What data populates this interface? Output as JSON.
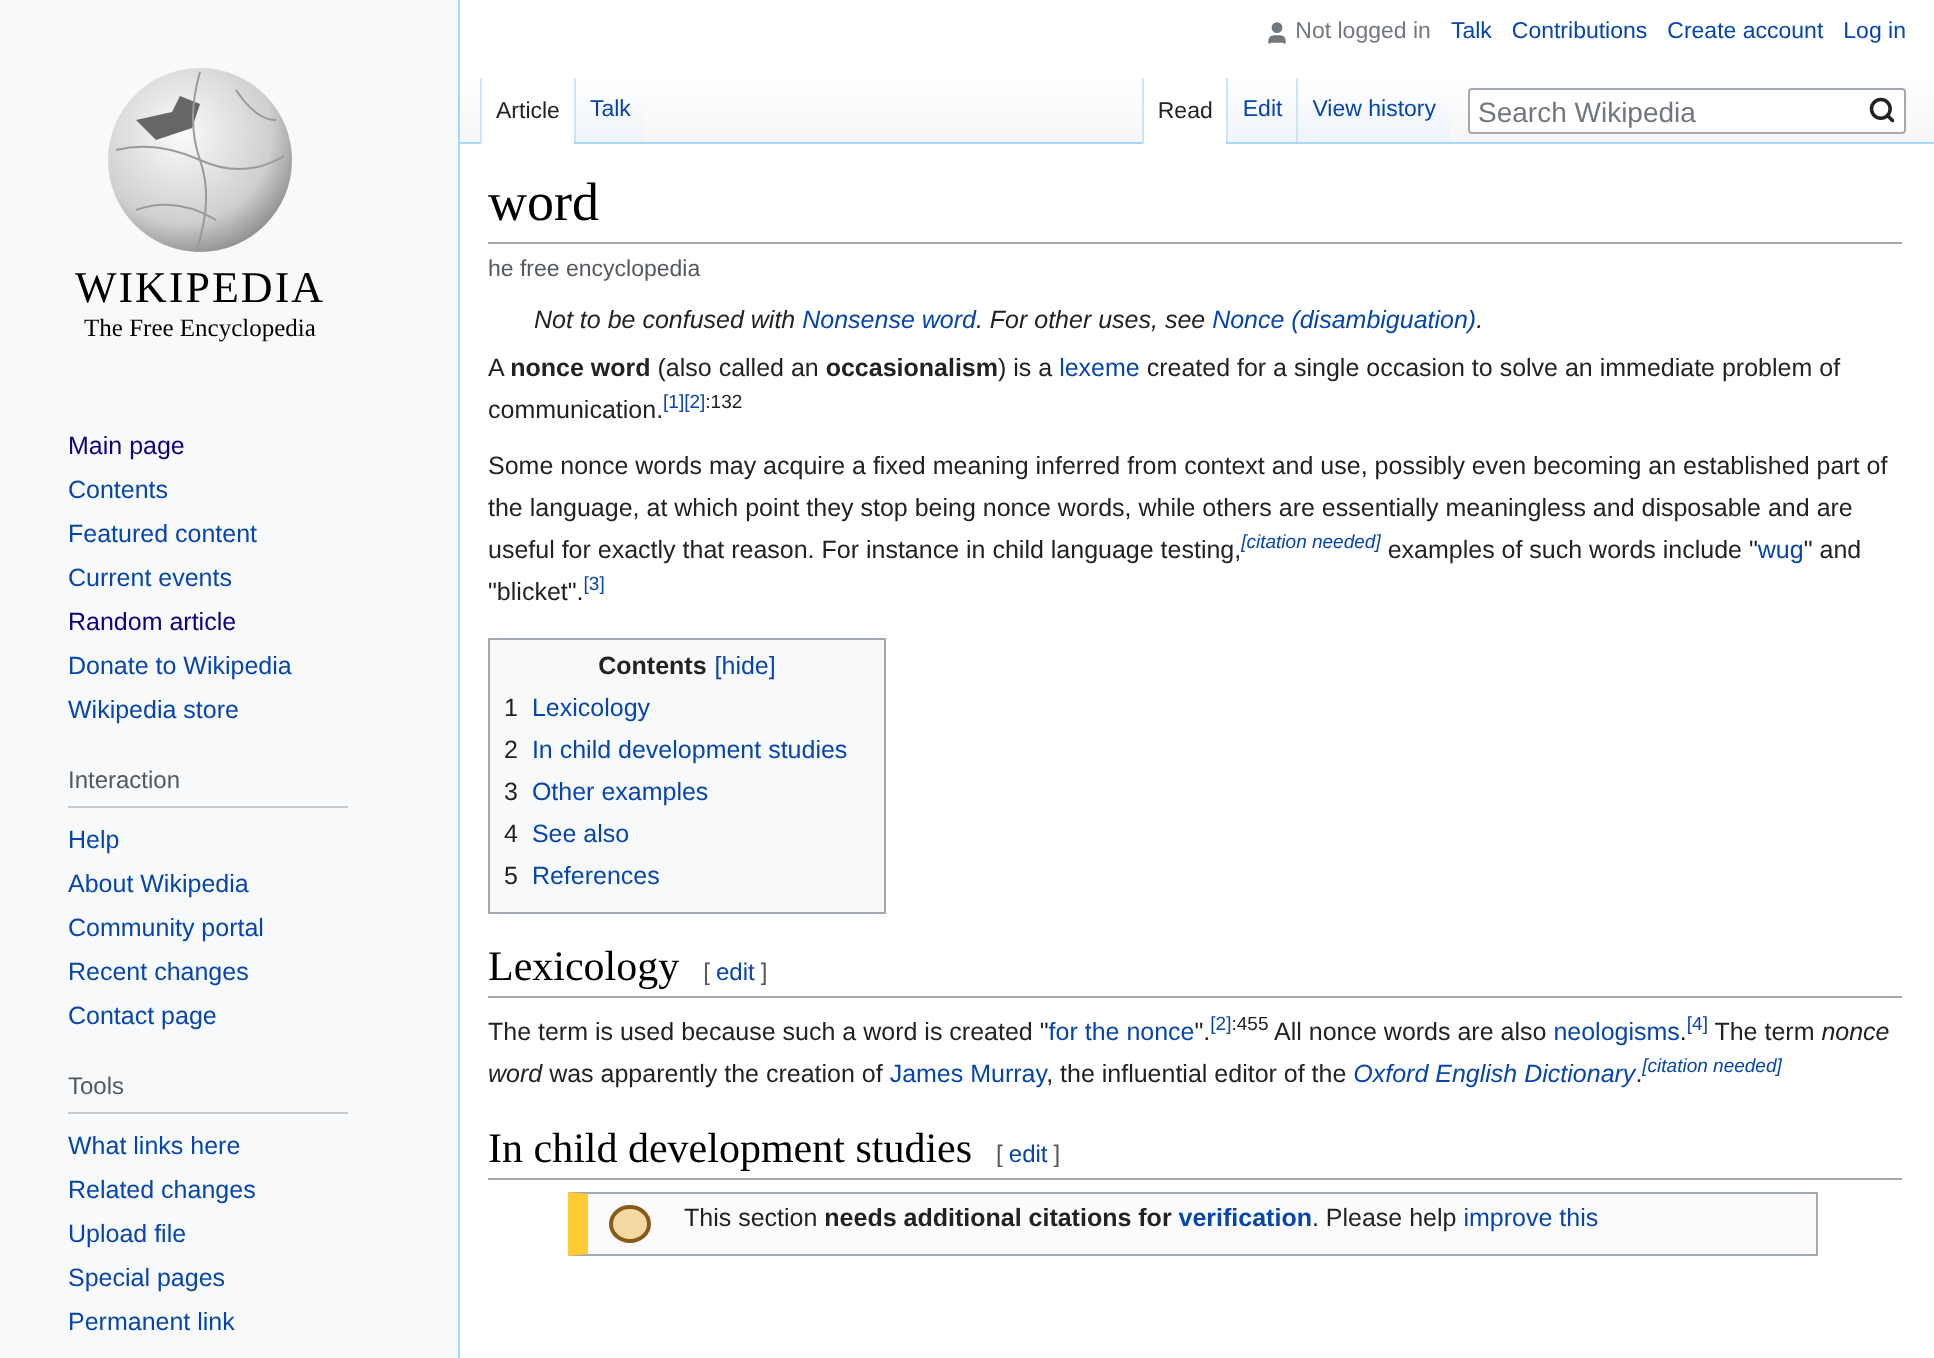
{
  "personal": {
    "status": "Not logged in",
    "links": [
      "Talk",
      "Contributions",
      "Create account",
      "Log in"
    ]
  },
  "namespace_tabs": [
    {
      "label": "Article",
      "selected": true
    },
    {
      "label": "Talk",
      "selected": false
    }
  ],
  "view_tabs": [
    {
      "label": "Read",
      "selected": true
    },
    {
      "label": "Edit",
      "selected": false
    },
    {
      "label": "View history",
      "selected": false
    }
  ],
  "search": {
    "placeholder": "Search Wikipedia"
  },
  "article": {
    "title": "word",
    "tagline": "he free encyclopedia",
    "hatnote": [
      {
        "kind": "text",
        "text": "Not to be confused with "
      },
      {
        "kind": "link",
        "text": "Nonsense word"
      },
      {
        "kind": "text",
        "text": ". For other uses, see "
      },
      {
        "kind": "link",
        "text": "Nonce (disambiguation)"
      },
      {
        "kind": "text",
        "text": "."
      }
    ],
    "intro": [
      [
        {
          "kind": "text",
          "text": "A "
        },
        {
          "kind": "bold",
          "text": "nonce word"
        },
        {
          "kind": "text",
          "text": " (also called an "
        },
        {
          "kind": "bold",
          "text": "occasionalism"
        },
        {
          "kind": "text",
          "text": ") is a "
        },
        {
          "kind": "link",
          "text": "lexeme"
        },
        {
          "kind": "text",
          "text": " created for a single occasion to solve an immediate problem of communication."
        },
        {
          "kind": "ref",
          "text": "[1]"
        },
        {
          "kind": "ref",
          "text": "[2]"
        },
        {
          "kind": "sup",
          "text": ":132"
        }
      ],
      [
        {
          "kind": "text",
          "text": "Some nonce words may acquire a fixed meaning inferred from context and use, possibly even becoming an established part of the language, at which point they stop being nonce words, while others are essentially meaningless and disposable and are useful for exactly that reason. For instance in child language testing,"
        },
        {
          "kind": "note",
          "text": "[citation needed]"
        },
        {
          "kind": "text",
          "text": " examples of such words include \""
        },
        {
          "kind": "link",
          "text": "wug"
        },
        {
          "kind": "text",
          "text": "\" and \"blicket\"."
        },
        {
          "kind": "ref",
          "text": "[3]"
        }
      ]
    ],
    "toc": {
      "title": "Contents",
      "toggle": "[hide]",
      "items": [
        {
          "number": "1",
          "label": "Lexicology"
        },
        {
          "number": "2",
          "label": "In child development studies"
        },
        {
          "number": "3",
          "label": "Other examples"
        },
        {
          "number": "4",
          "label": "See also"
        },
        {
          "number": "5",
          "label": "References"
        }
      ]
    },
    "sections": [
      {
        "heading": "Lexicology",
        "edit": {
          "open": "[",
          "label": "edit",
          "close": "]"
        },
        "paragraphs": [
          [
            {
              "kind": "text",
              "text": "The term is used because such a word is created \""
            },
            {
              "kind": "link",
              "text": "for the nonce"
            },
            {
              "kind": "text",
              "text": "\"."
            },
            {
              "kind": "ref",
              "text": "[2]"
            },
            {
              "kind": "sup",
              "text": ":455"
            },
            {
              "kind": "text",
              "text": " All nonce words are also "
            },
            {
              "kind": "link",
              "text": "neologisms"
            },
            {
              "kind": "text",
              "text": "."
            },
            {
              "kind": "ref",
              "text": "[4]"
            },
            {
              "kind": "text",
              "text": " The term "
            },
            {
              "kind": "italic",
              "text": "nonce word"
            },
            {
              "kind": "text",
              "text": " was apparently the creation of "
            },
            {
              "kind": "link",
              "text": "James Murray"
            },
            {
              "kind": "text",
              "text": ", the influential editor of the "
            },
            {
              "kind": "italic-link",
              "text": "Oxford English Dictionary"
            },
            {
              "kind": "text",
              "text": "."
            },
            {
              "kind": "note",
              "text": "[citation needed]"
            }
          ]
        ]
      },
      {
        "heading": "In child development studies",
        "edit": {
          "open": "[",
          "label": "edit",
          "close": "]"
        },
        "notice": [
          {
            "kind": "text",
            "text": "This section "
          },
          {
            "kind": "bold",
            "text": "needs additional citations for "
          },
          {
            "kind": "bold-link",
            "text": "verification"
          },
          {
            "kind": "text",
            "text": ". Please help "
          },
          {
            "kind": "link",
            "text": "improve this"
          }
        ]
      }
    ]
  },
  "sidebar": {
    "wordmark": "WIKIPEDIA",
    "motto": "The Free Encyclopedia",
    "portals": [
      {
        "links": [
          {
            "label": "Main page",
            "visited": true
          },
          {
            "label": "Contents",
            "visited": false
          },
          {
            "label": "Featured content",
            "visited": false
          },
          {
            "label": "Current events",
            "visited": false
          },
          {
            "label": "Random article",
            "visited": true
          },
          {
            "label": "Donate to Wikipedia",
            "visited": false
          },
          {
            "label": "Wikipedia store",
            "visited": false
          }
        ]
      },
      {
        "heading": "Interaction",
        "links": [
          {
            "label": "Help",
            "visited": false
          },
          {
            "label": "About Wikipedia",
            "visited": false
          },
          {
            "label": "Community portal",
            "visited": false
          },
          {
            "label": "Recent changes",
            "visited": false
          },
          {
            "label": "Contact page",
            "visited": false
          }
        ]
      },
      {
        "heading": "Tools",
        "links": [
          {
            "label": "What links here",
            "visited": false
          },
          {
            "label": "Related changes",
            "visited": false
          },
          {
            "label": "Upload file",
            "visited": false
          },
          {
            "label": "Special pages",
            "visited": false
          },
          {
            "label": "Permanent link",
            "visited": false
          }
        ]
      }
    ]
  }
}
